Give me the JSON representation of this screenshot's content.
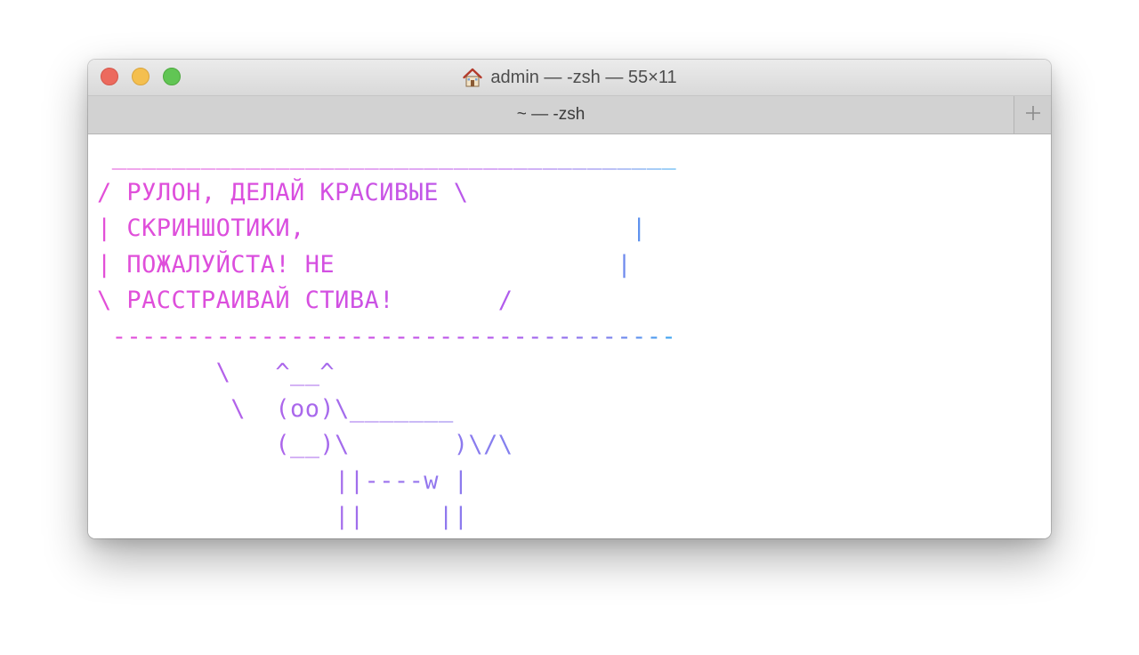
{
  "window": {
    "title": "admin — -zsh — 55×11",
    "title_icon": "home-icon",
    "tab_label": "~ — -zsh",
    "new_tab_icon": "plus-icon"
  },
  "terminal": {
    "lines": [
      " ______________________________________",
      "/ РУЛОН, ДЕЛАЙ КРАСИВЫЕ \\",
      "| СКРИНШОТИКИ,                      |",
      "| ПОЖАЛУЙСТА! НЕ                   |",
      "\\ РАССТРАИВАЙ СТИВА!       /",
      " --------------------------------------",
      "        \\   ^__^",
      "         \\  (oo)\\_______",
      "            (__)\\       )\\/\\",
      "                ||----w |",
      "                ||     ||"
    ]
  },
  "colors": {
    "bubble_gradient": [
      "#e24fd8",
      "#d84ee0",
      "#b25bec",
      "#7f7fec",
      "#3aa8f0"
    ],
    "cow_gradient": [
      "#c456e6",
      "#a66aec",
      "#7f83ef",
      "#6f8ff0"
    ],
    "close": "#ec6a5e",
    "minimize": "#f4bf4f",
    "maximize": "#61c554"
  }
}
